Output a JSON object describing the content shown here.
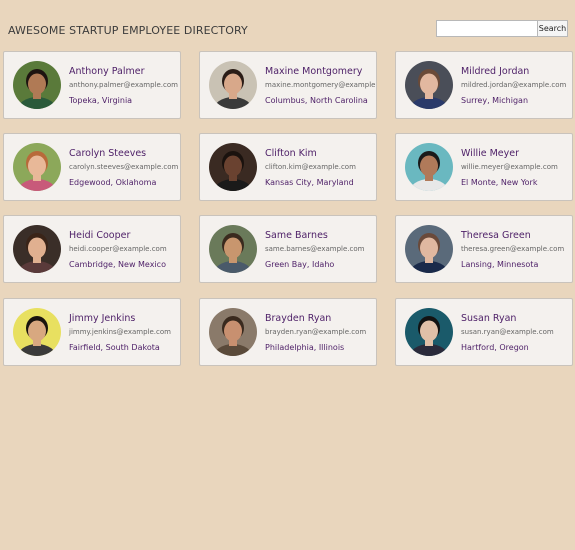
{
  "header": {
    "title": "AWESOME STARTUP EMPLOYEE DIRECTORY",
    "search_placeholder": "",
    "search_button": "Search"
  },
  "employees": [
    {
      "name": "Anthony Palmer",
      "email": "anthony.palmer@example.com",
      "location": "Topeka, Virginia",
      "avatar": {
        "bg": "#5a7a3a",
        "skin": "#b07a55",
        "hair": "#1e1410",
        "shirt": "#2a5a3a"
      }
    },
    {
      "name": "Maxine Montgomery",
      "email": "maxine.montgomery@example.com",
      "location": "Columbus, North Carolina",
      "avatar": {
        "bg": "#c9c2b4",
        "skin": "#d8a88a",
        "hair": "#2a1c16",
        "shirt": "#3a3a3a"
      }
    },
    {
      "name": "Mildred Jordan",
      "email": "mildred.jordan@example.com",
      "location": "Surrey, Michigan",
      "avatar": {
        "bg": "#4a4e58",
        "skin": "#e2b8a0",
        "hair": "#6a4a38",
        "shirt": "#2a3a6a"
      }
    },
    {
      "name": "Carolyn Steeves",
      "email": "carolyn.steeves@example.com",
      "location": "Edgewood, Oklahoma",
      "avatar": {
        "bg": "#8ca85a",
        "skin": "#e8b898",
        "hair": "#b86a3a",
        "shirt": "#c85a7a"
      }
    },
    {
      "name": "Clifton Kim",
      "email": "clifton.kim@example.com",
      "location": "Kansas City, Maryland",
      "avatar": {
        "bg": "#3a2a22",
        "skin": "#6a4230",
        "hair": "#1a120e",
        "shirt": "#1a1a1a"
      }
    },
    {
      "name": "Willie Meyer",
      "email": "willie.meyer@example.com",
      "location": "El Monte, New York",
      "avatar": {
        "bg": "#6ab8c0",
        "skin": "#b07a5a",
        "hair": "#1a1a1a",
        "shirt": "#e8e8e8"
      }
    },
    {
      "name": "Heidi Cooper",
      "email": "heidi.cooper@example.com",
      "location": "Cambridge, New Mexico",
      "avatar": {
        "bg": "#3a2e28",
        "skin": "#e0b090",
        "hair": "#3a2418",
        "shirt": "#5a3a3a"
      }
    },
    {
      "name": "Same Barnes",
      "email": "same.barnes@example.com",
      "location": "Green Bay, Idaho",
      "avatar": {
        "bg": "#6a7a5a",
        "skin": "#c8966e",
        "hair": "#3a2a1e",
        "shirt": "#4a5a6a"
      }
    },
    {
      "name": "Theresa Green",
      "email": "theresa.green@example.com",
      "location": "Lansing, Minnesota",
      "avatar": {
        "bg": "#5a6a7a",
        "skin": "#e0b8a0",
        "hair": "#6a4a3a",
        "shirt": "#1a2a4a"
      }
    },
    {
      "name": "Jimmy Jenkins",
      "email": "jimmy.jenkins@example.com",
      "location": "Fairfield, South Dakota",
      "avatar": {
        "bg": "#e8e060",
        "skin": "#d8a880",
        "hair": "#1a140e",
        "shirt": "#3a3a3a"
      }
    },
    {
      "name": "Brayden Ryan",
      "email": "brayden.ryan@example.com",
      "location": "Philadelphia, Illinois",
      "avatar": {
        "bg": "#8a7a6a",
        "skin": "#c89070",
        "hair": "#3a2a1e",
        "shirt": "#5a4a3a"
      }
    },
    {
      "name": "Susan Ryan",
      "email": "susan.ryan@example.com",
      "location": "Hartford, Oregon",
      "avatar": {
        "bg": "#1a5a6a",
        "skin": "#e0c0a8",
        "hair": "#121212",
        "shirt": "#2a2a3a"
      }
    }
  ]
}
